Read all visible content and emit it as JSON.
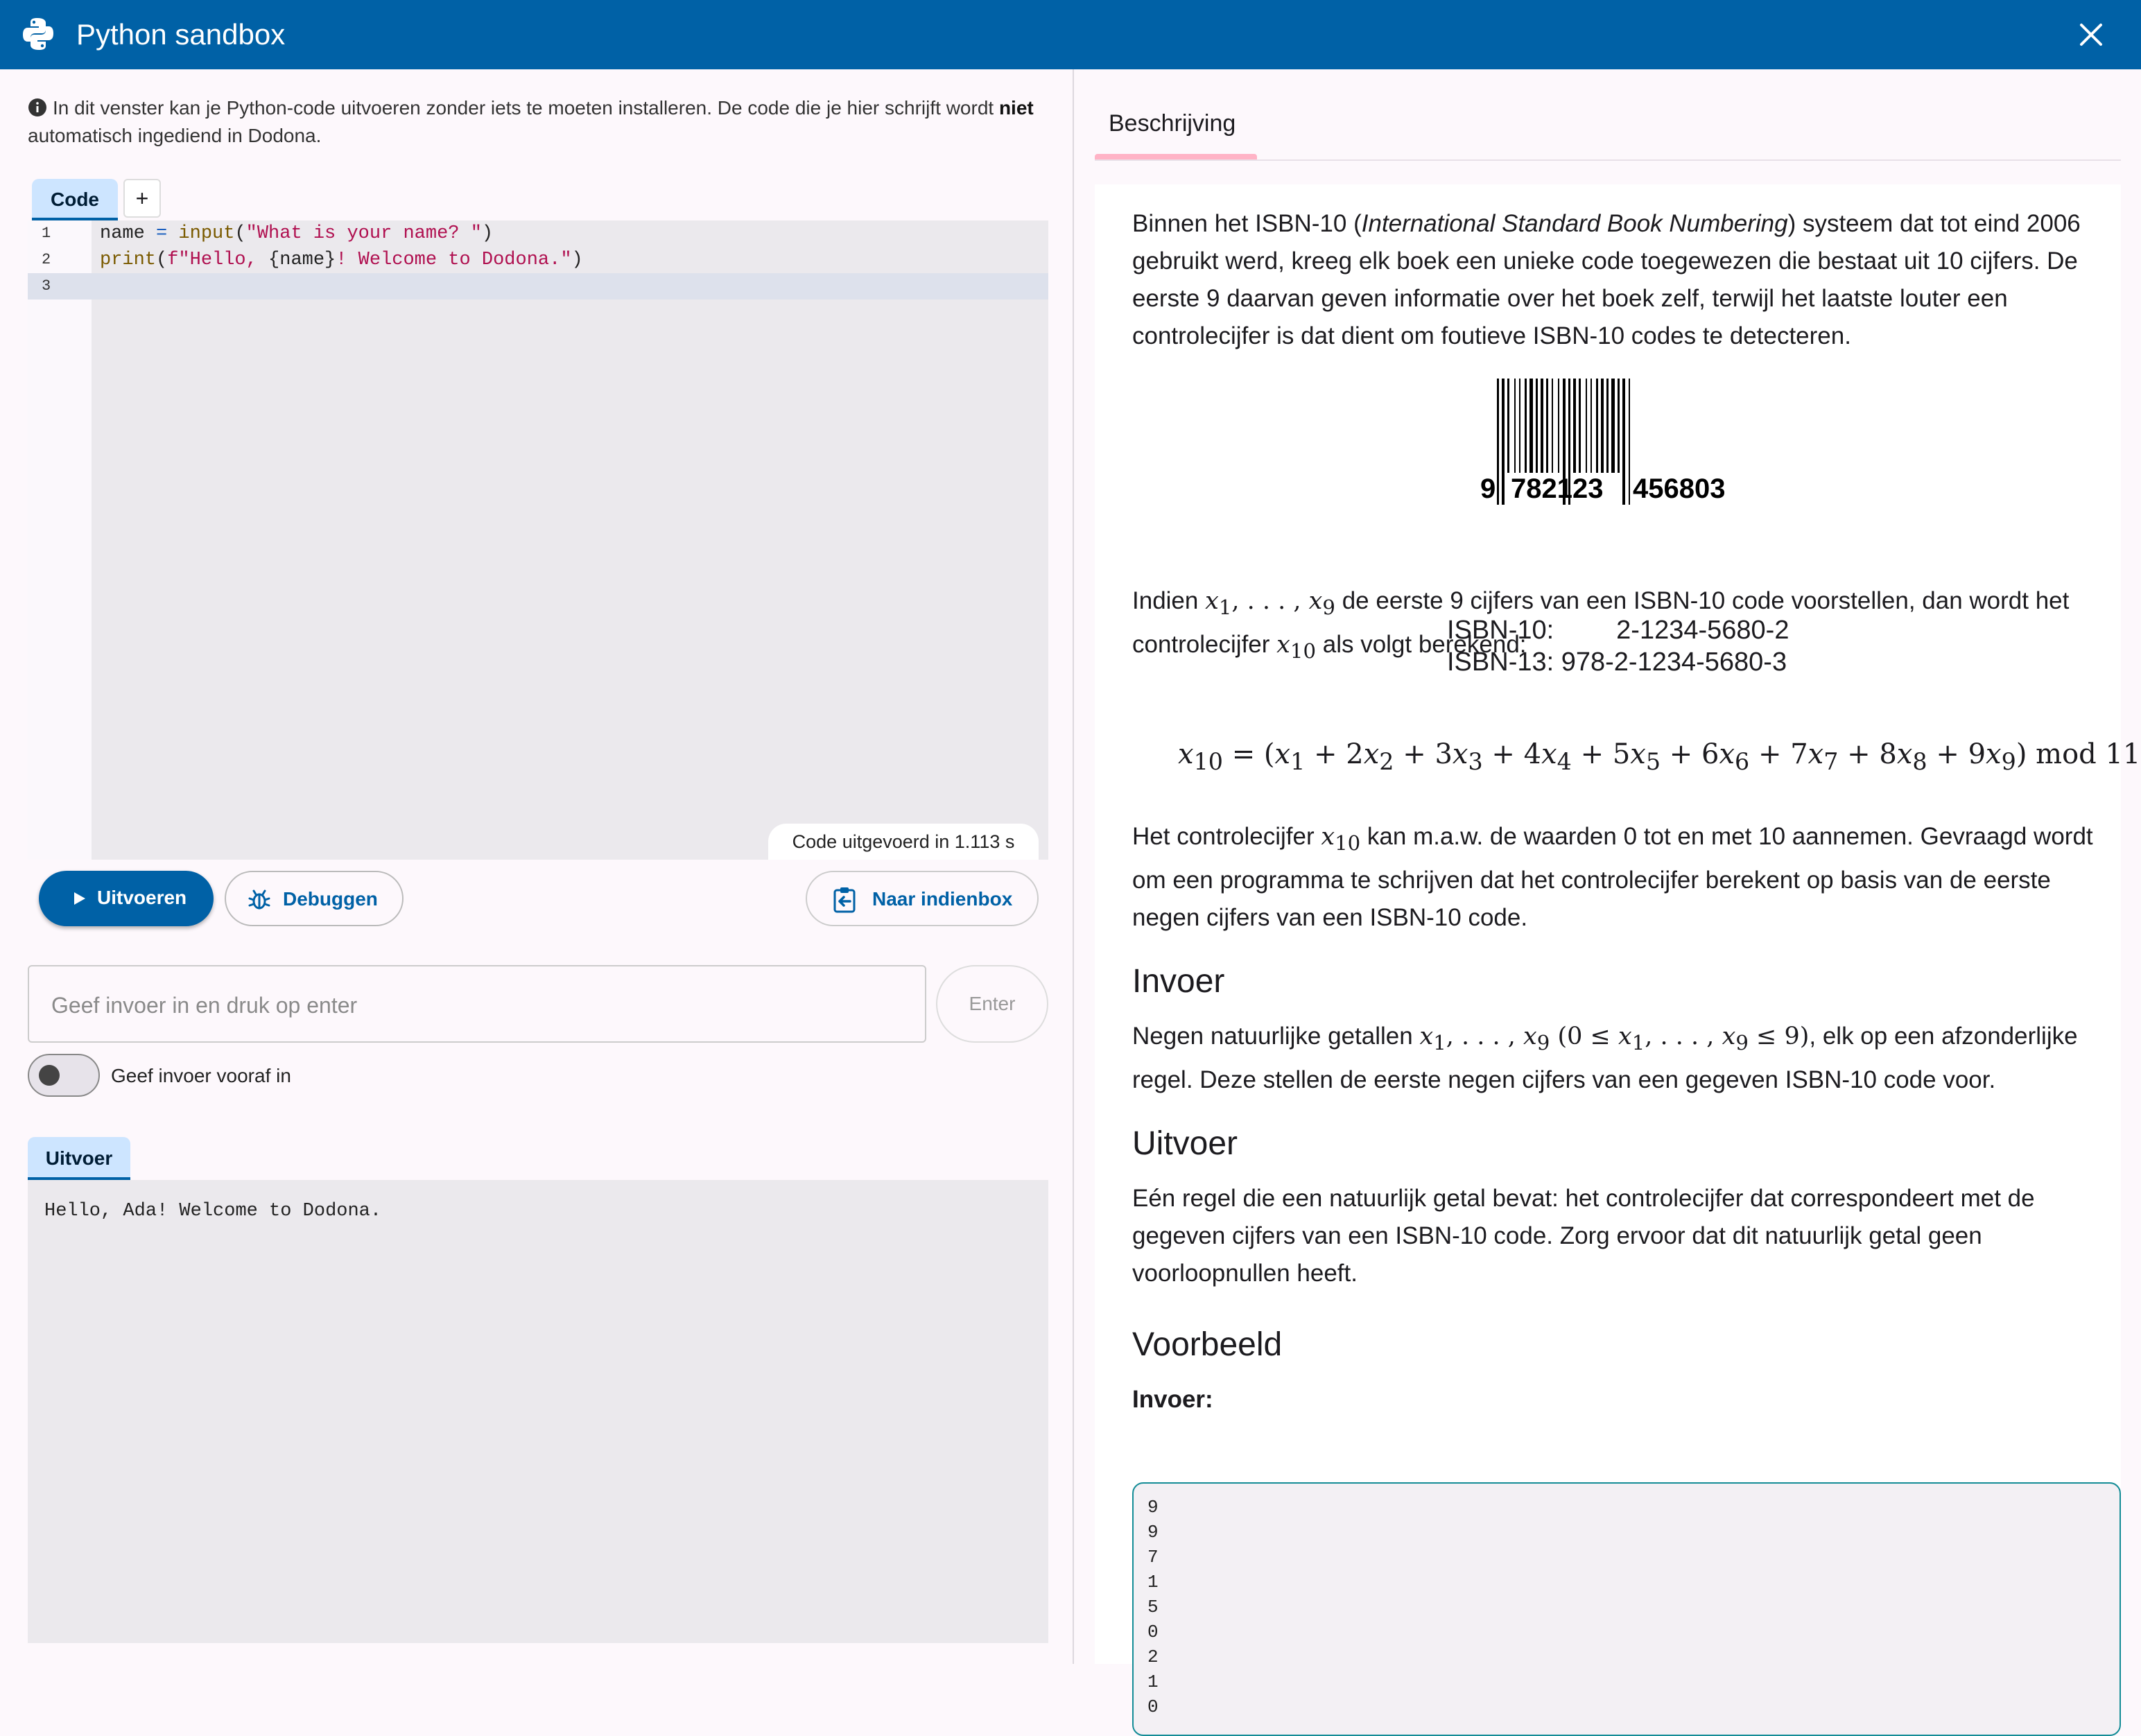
{
  "window": {
    "title": "Python sandbox"
  },
  "info": {
    "text_before": "In dit venster kan je Python-code uitvoeren zonder iets te moeten installeren. De code die je hier schrijft wordt ",
    "bold": "niet",
    "text_after": " automatisch ingediend in Dodona."
  },
  "editor": {
    "tab_label": "Code",
    "add_tab": "+",
    "lines": [
      {
        "n": "1",
        "parts": [
          "name ",
          "=",
          " ",
          "input",
          "(",
          "\"What is your name? \"",
          ")"
        ]
      },
      {
        "n": "2",
        "parts": [
          "print",
          "(",
          "f\"Hello, ",
          "{name}",
          "! Welcome to Dodona.\"",
          ")"
        ]
      },
      {
        "n": "3",
        "parts": []
      }
    ],
    "exec_status": "Code uitgevoerd in 1.113 s"
  },
  "actions": {
    "run": "Uitvoeren",
    "debug": "Debuggen",
    "submit": "Naar indienbox"
  },
  "stdin": {
    "placeholder": "Geef invoer in en druk op enter",
    "value": "",
    "enter": "Enter",
    "toggle_label": "Geef invoer vooraf in",
    "toggle_on": false
  },
  "output": {
    "tab_label": "Uitvoer",
    "text": "Hello, Ada! Welcome to Dodona."
  },
  "description": {
    "tab": "Beschrijving",
    "intro_pre": "Binnen het ISBN-10 (",
    "intro_em": "International Standard Book Numbering",
    "intro_post": ") systeem dat tot eind 2006 gebruikt werd, kreeg elk boek een unieke code toegewezen die bestaat uit 10 cijfers. De eerste 9 daarvan geven informatie over het boek zelf, terwijl het laatste louter een controlecijfer is dat dient om foutieve ISBN-10 codes te detecteren.",
    "barcode_digits": {
      "first": "9",
      "left": "782123",
      "right": "456803"
    },
    "isbn10_label": "ISBN-10:",
    "isbn10_value": "2-1234-5680-2",
    "isbn13_label": "ISBN-13:",
    "isbn13_value": "978-2-1234-5680-3",
    "para2_a": "Indien ",
    "para2_b": " de eerste 9 cijfers van een ISBN-10 code voorstellen, dan wordt het controlecijfer ",
    "para2_c": " als volgt berekend:",
    "para3_a": "Het controlecijfer ",
    "para3_b": " kan m.a.w. de waarden 0 tot en met 10 aannemen. Gevraagd wordt om een programma te schrijven dat het controlecijfer berekent op basis van de eerste negen cijfers van een ISBN-10 code.",
    "invoer_heading": "Invoer",
    "invoer_a": "Negen natuurlijke getallen ",
    "invoer_b": ", elk op een afzonderlijke regel. Deze stellen de eerste negen cijfers van een gegeven ISBN-10 code voor.",
    "uitvoer_heading": "Uitvoer",
    "uitvoer_text": "Eén regel die een natuurlijk getal bevat: het controlecijfer dat correspondeert met de gegeven cijfers van een ISBN-10 code. Zorg ervoor dat dit natuurlijk getal geen voorloopnullen heeft.",
    "voorbeeld_heading": "Voorbeeld",
    "example_input_label": "Invoer:",
    "example_input": [
      "9",
      "9",
      "7",
      "1",
      "5",
      "0",
      "2",
      "1",
      "0"
    ]
  },
  "icons": {
    "logo": "python-logo-icon",
    "close": "close-icon",
    "info": "info-icon",
    "run": "play-icon",
    "debug": "bug-icon",
    "submit": "clipboard-arrow-icon"
  },
  "colors": {
    "primary": "#0061a6",
    "tab_bg": "#cde5ff",
    "tab_indicator": "#ffb3c6",
    "example_border": "#138c96"
  }
}
